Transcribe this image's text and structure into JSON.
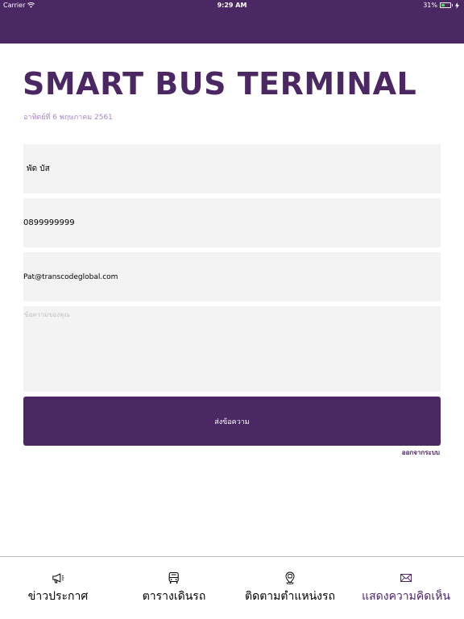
{
  "status_bar": {
    "carrier": "Carrier",
    "time": "9:29 AM",
    "battery": "31%"
  },
  "header": {
    "title": "SMART BUS TERMINAL",
    "date": "อาทิตย์ที่ 6 พฤษภาคม 2561"
  },
  "form": {
    "name_value": "พัด บัส",
    "phone_value": "0899999999",
    "email_value": "Pat@transcodeglobal.com",
    "message_placeholder": "ข้อความของคุณ",
    "send_label": "ส่งข้อความ",
    "logout_label": "ออกจากระบบ"
  },
  "tabs": [
    {
      "label": "ข่าวประกาศ",
      "icon": "megaphone-icon"
    },
    {
      "label": "ตารางเดินรถ",
      "icon": "bus-icon"
    },
    {
      "label": "ติดตามตำแหน่งรถ",
      "icon": "location-pin-icon"
    },
    {
      "label": "แสดงความคิดเห็น",
      "icon": "envelope-icon",
      "active": true
    }
  ],
  "colors": {
    "brand": "#4b2763",
    "date_text": "#a987c1",
    "field_bg": "#f3f3f3",
    "battery_fill": "#4cd964"
  }
}
